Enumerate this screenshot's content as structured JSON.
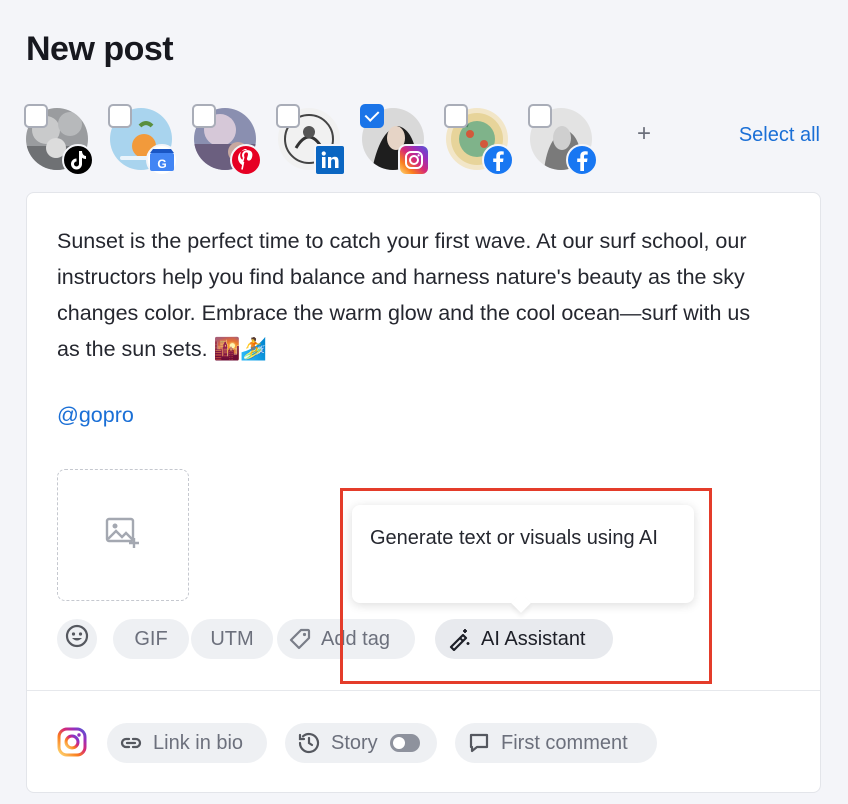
{
  "page": {
    "title": "New post"
  },
  "accounts": [
    {
      "platform": "TikTok",
      "checked": false,
      "badge_icon": "tiktok-icon"
    },
    {
      "platform": "Google Business",
      "checked": false,
      "badge_icon": "google-business-icon"
    },
    {
      "platform": "Pinterest",
      "checked": false,
      "badge_icon": "pinterest-icon"
    },
    {
      "platform": "LinkedIn",
      "checked": false,
      "badge_icon": "linkedin-icon"
    },
    {
      "platform": "Instagram",
      "checked": true,
      "badge_icon": "instagram-icon"
    },
    {
      "platform": "Facebook",
      "checked": false,
      "badge_icon": "facebook-icon"
    },
    {
      "platform": "Facebook",
      "checked": false,
      "badge_icon": "facebook-icon"
    }
  ],
  "add_account_label": "+",
  "select_all_label": "Select all",
  "post": {
    "text": "Sunset is the perfect time to catch your first wave. At our surf school, our instructors help you find balance and harness nature's beauty as the sky changes color. Embrace the warm glow and the cool ocean—surf with us as the sun sets. 🌇🏄",
    "mention": "@gopro"
  },
  "toolbar": {
    "emoji_icon": "emoji-icon",
    "gif_label": "GIF",
    "utm_label": "UTM",
    "add_tag_label": "Add tag",
    "ai_assistant_label": "AI Assistant"
  },
  "tooltip": {
    "text": "Generate text or visuals using AI"
  },
  "bottom_bar": {
    "platform_icon": "instagram-icon",
    "link_in_bio_label": "Link in bio",
    "story_label": "Story",
    "story_enabled": false,
    "first_comment_label": "First comment"
  },
  "colors": {
    "accent": "#1a74e8",
    "link": "#1a6fd6",
    "highlight": "#e43c2a",
    "background": "#f4f5f9"
  }
}
